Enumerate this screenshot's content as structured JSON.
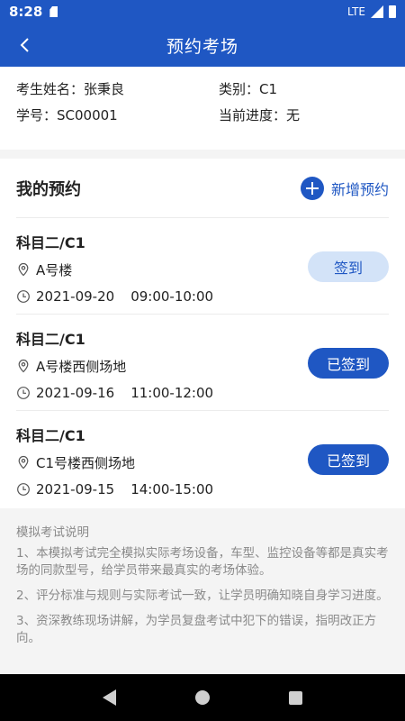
{
  "status": {
    "time": "8:28",
    "network": "LTE"
  },
  "nav": {
    "title": "预约考场"
  },
  "student": {
    "name": "考生姓名：张秉良",
    "category": "类别：C1",
    "id": "学号：SC00001",
    "progress": "当前进度：无"
  },
  "appointments": {
    "title": "我的预约",
    "add_label": "新增预约",
    "items": [
      {
        "subject": "科目二/C1",
        "location": "A号楼",
        "date": "2021-09-20",
        "time": "09:00-10:00",
        "action": "签到",
        "state": "pending"
      },
      {
        "subject": "科目二/C1",
        "location": "A号楼西侧场地",
        "date": "2021-09-16",
        "time": "11:00-12:00",
        "action": "已签到",
        "state": "done"
      },
      {
        "subject": "科目二/C1",
        "location": "C1号楼西侧场地",
        "date": "2021-09-15",
        "time": "14:00-15:00",
        "action": "已签到",
        "state": "done"
      }
    ]
  },
  "notes": {
    "title": "模拟考试说明",
    "lines": [
      "1、本模拟考试完全模拟实际考场设备，车型、监控设备等都是真实考场的同款型号，给学员带来最真实的考场体验。",
      "2、评分标准与规则与实际考试一致，让学员明确知晓自身学习进度。",
      "3、资深教练现场讲解，为学员复盘考试中犯下的错误，指明改正方向。"
    ]
  },
  "colors": {
    "brand": "#1f57c3",
    "button_light": "#d3e3f8",
    "muted_text": "#8a8a8a"
  }
}
